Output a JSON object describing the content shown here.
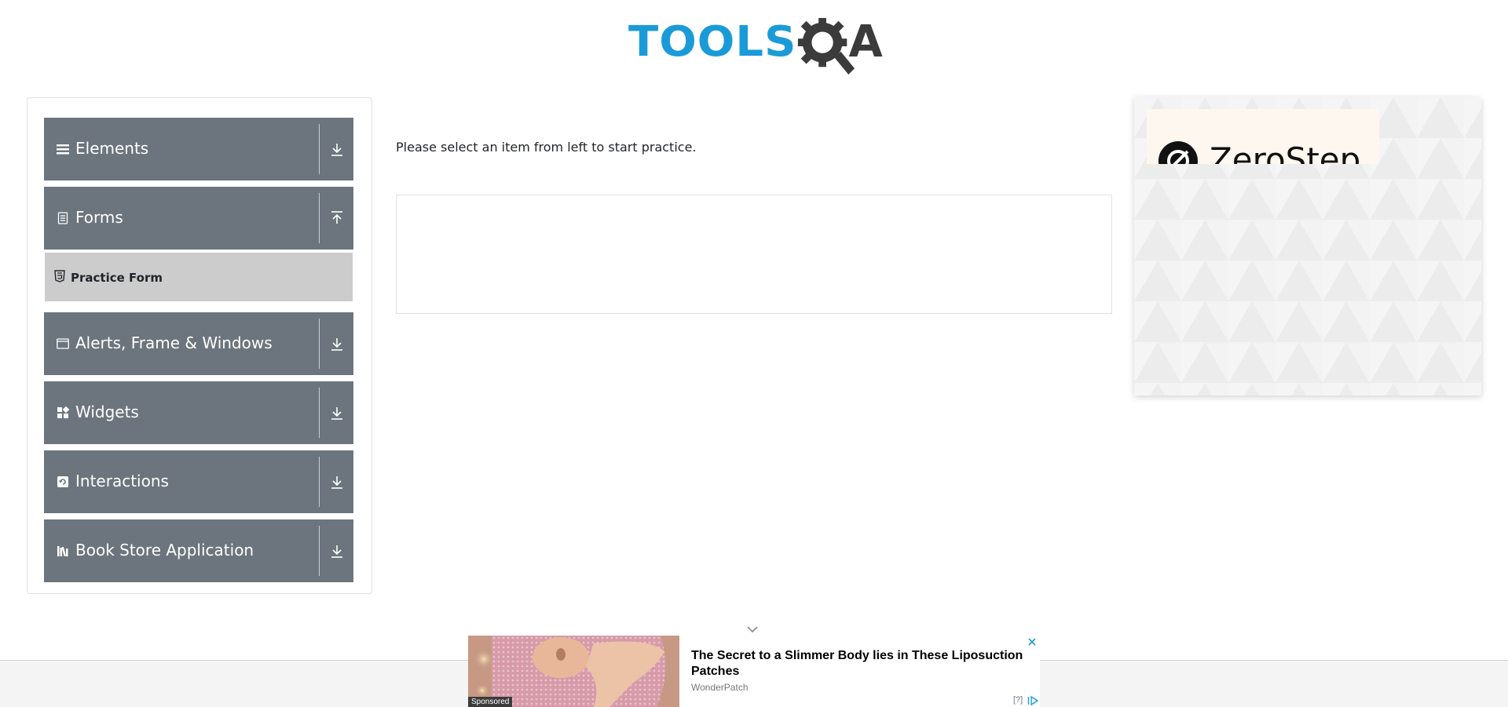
{
  "header": {
    "logo_part1": "TOOLS",
    "logo_part2": "A",
    "logo_colors": {
      "tools": "#1a9bd7",
      "qa": "#3b3b3b"
    }
  },
  "sidebar": {
    "groups": [
      {
        "label": "Elements",
        "icon": "menu-icon",
        "expanded": false
      },
      {
        "label": "Forms",
        "icon": "form-icon",
        "expanded": true
      },
      {
        "label": "Alerts, Frame & Windows",
        "icon": "window-icon",
        "expanded": false
      },
      {
        "label": "Widgets",
        "icon": "widgets-icon",
        "expanded": false
      },
      {
        "label": "Interactions",
        "icon": "interactions-icon",
        "expanded": false
      },
      {
        "label": "Book Store Application",
        "icon": "books-icon",
        "expanded": false
      }
    ],
    "forms_items": [
      {
        "label": "Practice Form",
        "icon": "html5-icon"
      }
    ]
  },
  "main": {
    "intro_text": "Please select an item from left to start practice."
  },
  "side_ad": {
    "brand": "ZeroStep"
  },
  "bottom_ad": {
    "headline": "The Secret to a Slimmer Body lies in These Liposuction Patches",
    "advertiser": "WonderPatch",
    "sponsored_label": "Sponsored",
    "info_label": "[?]"
  },
  "colors": {
    "sidebar_group_bg": "#6c757d",
    "submenu_active_bg": "#cccccc"
  }
}
